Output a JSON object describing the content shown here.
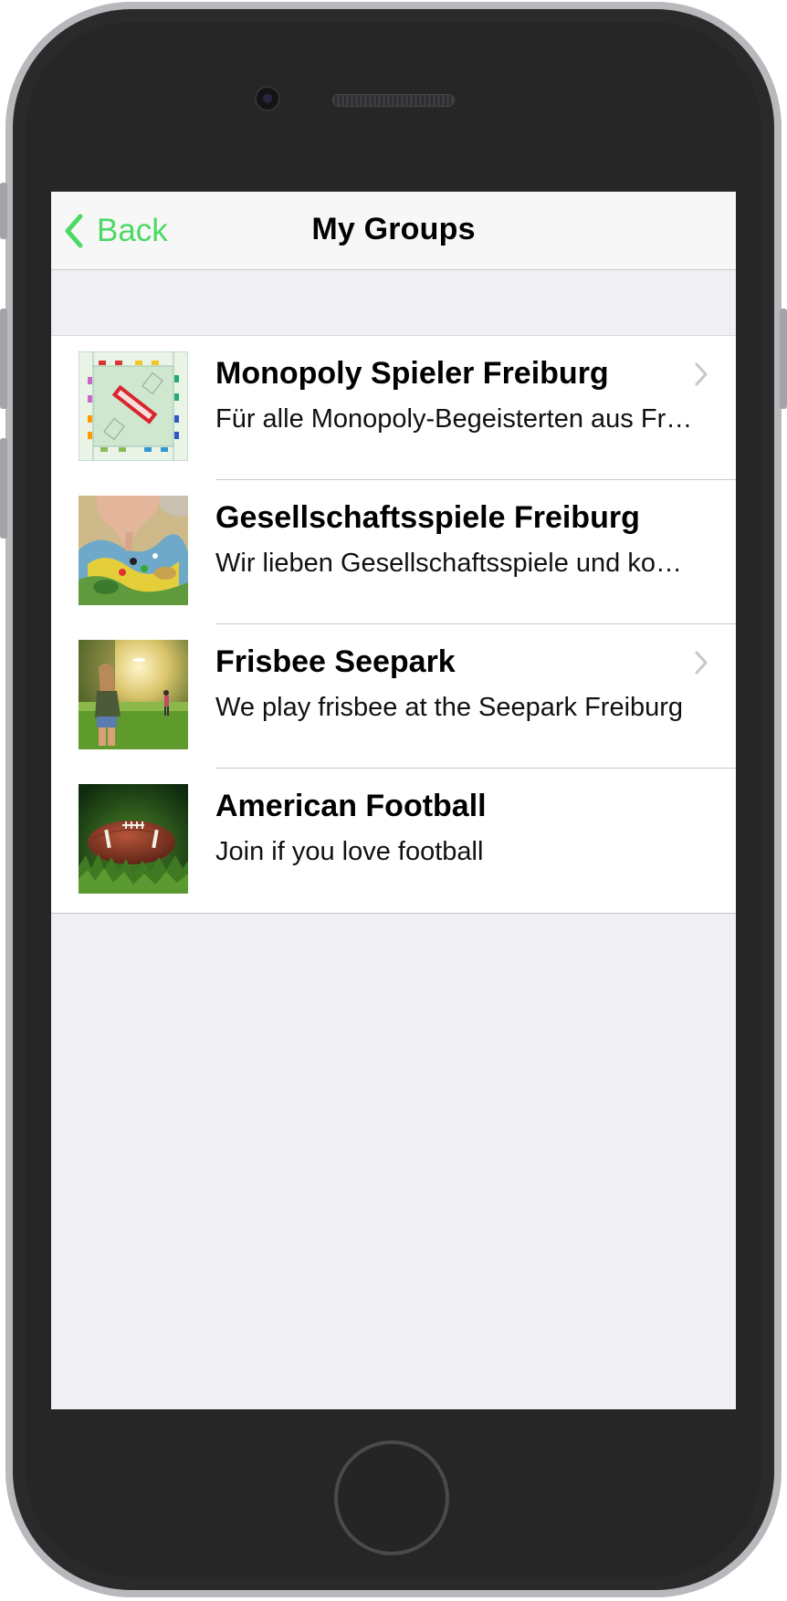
{
  "nav": {
    "back_label": "Back",
    "title": "My Groups"
  },
  "groups": [
    {
      "name": "Monopoly Spieler Freiburg",
      "description": "Für alle Monopoly-Begeisterten aus Freiburg",
      "image": "monopoly-board",
      "has_chevron": true
    },
    {
      "name": "Gesellschaftsspiele Freiburg",
      "description": "Wir lieben Gesellschaftsspiele und kommen regelmäßig zusammen",
      "image": "board-game-hand",
      "has_chevron": false
    },
    {
      "name": "Frisbee Seepark",
      "description": "We play frisbee at the Seepark Freiburg",
      "image": "frisbee-players",
      "has_chevron": true
    },
    {
      "name": "American Football",
      "description": "Join if you love football",
      "image": "football-on-grass",
      "has_chevron": false
    }
  ],
  "colors": {
    "accent": "#4cd964",
    "background": "#efeff4",
    "nav_bar": "#f7f7f7",
    "separator": "#c8c7cc"
  },
  "icons": {
    "back": "chevron-left-icon",
    "disclosure": "chevron-right-icon"
  }
}
